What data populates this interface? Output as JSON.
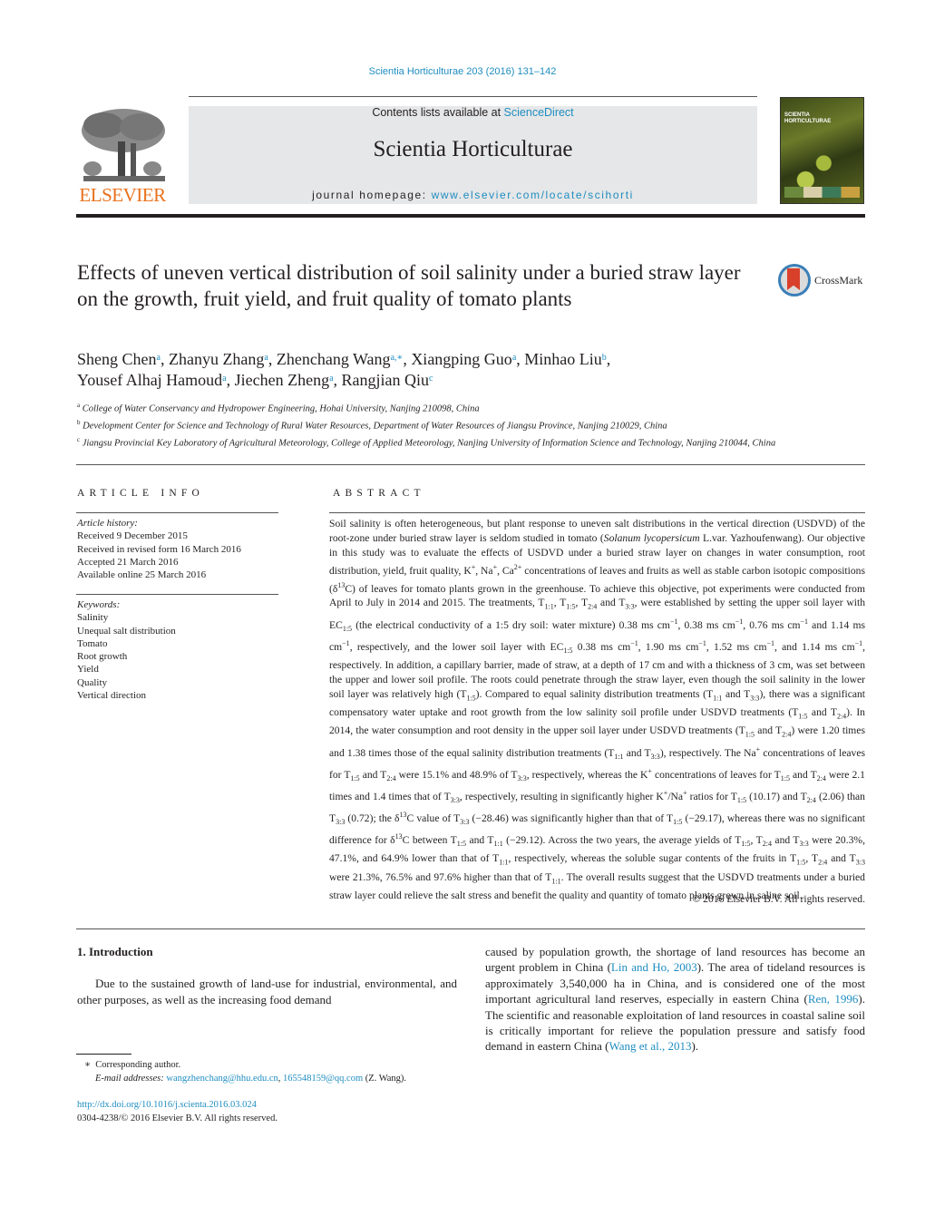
{
  "header": {
    "citation": "Scientia Horticulturae 203 (2016) 131–142",
    "contents_prefix": "Contents lists available at ",
    "contents_link": "ScienceDirect",
    "journal_name": "Scientia Horticulturae",
    "homepage_prefix": "journal homepage: ",
    "homepage_link": "www.elsevier.com/locate/scihorti",
    "publisher_logo_text": "ELSEVIER",
    "cover_title_line1": "SCIENTIA",
    "cover_title_line2": "HORTICULTURAE",
    "colors": {
      "link": "#1f8dc1",
      "publisher": "#e9711c",
      "box": "#e6e7e8"
    }
  },
  "article": {
    "title": "Effects of uneven vertical distribution of soil salinity under a buried straw layer on the growth, fruit yield, and fruit quality of tomato plants",
    "crossmark_label": "CrossMark",
    "authors": [
      {
        "name": "Sheng Chen",
        "sup": "a",
        "sep": ", "
      },
      {
        "name": "Zhanyu Zhang",
        "sup": "a",
        "sep": ", "
      },
      {
        "name": "Zhenchang Wang",
        "sup": "a,∗",
        "sep": ", "
      },
      {
        "name": "Xiangping Guo",
        "sup": "a",
        "sep": ", "
      },
      {
        "name": "Minhao Liu",
        "sup": "b",
        "sep": ","
      },
      {
        "name": "Yousef Alhaj Hamoud",
        "sup": "a",
        "sep": ", "
      },
      {
        "name": "Jiechen Zheng",
        "sup": "a",
        "sep": ", "
      },
      {
        "name": "Rangjian Qiu",
        "sup": "c",
        "sep": ""
      }
    ],
    "affiliations": [
      {
        "key": "a",
        "text": "College of Water Conservancy and Hydropower Engineering, Hohai University, Nanjing 210098, China"
      },
      {
        "key": "b",
        "text": "Development Center for Science and Technology of Rural Water Resources, Department of Water Resources of Jiangsu Province, Nanjing 210029, China"
      },
      {
        "key": "c",
        "text": "Jiangsu Provincial Key Laboratory of Agricultural Meteorology, College of Applied Meteorology, Nanjing University of Information Science and Technology, Nanjing 210044, China"
      }
    ]
  },
  "article_info": {
    "heading": "ARTICLE INFO",
    "history_label": "Article history:",
    "history": [
      "Received 9 December 2015",
      "Received in revised form 16 March 2016",
      "Accepted 21 March 2016",
      "Available online 25 March 2016"
    ],
    "keywords_label": "Keywords:",
    "keywords": [
      "Salinity",
      "Unequal salt distribution",
      "Tomato",
      "Root growth",
      "Yield",
      "Quality",
      "Vertical direction"
    ]
  },
  "abstract": {
    "heading": "ABSTRACT",
    "html": "Soil salinity is often heterogeneous, but plant response to uneven salt distributions in the vertical direction (USDVD) of the root-zone under buried straw layer is seldom studied in tomato (<i>Solanum lycopersicum</i> L.var. Yazhoufenwang). Our objective in this study was to evaluate the effects of USDVD under a buried straw layer on changes in water consumption, root distribution, yield, fruit quality, K<sup>+</sup>, Na<sup>+</sup>, Ca<sup>2+</sup> concentrations of leaves and fruits as well as stable carbon isotopic compositions (δ<sup>13</sup>C) of leaves for tomato plants grown in the greenhouse. To achieve this objective, pot experiments were conducted from April to July in 2014 and 2015. The treatments, T<sub>1:1</sub>, T<sub>1:5</sub>, T<sub>2:4</sub> and T<sub>3:3</sub>, were established by setting the upper soil layer with EC<sub>1:5</sub> (the electrical conductivity of a 1:5 dry soil: water mixture) 0.38 ms cm<sup>−1</sup>, 0.38 ms cm<sup>−1</sup>, 0.76 ms cm<sup>−1</sup> and 1.14 ms cm<sup>−1</sup>, respectively, and the lower soil layer with EC<sub>1:5</sub> 0.38 ms cm<sup>−1</sup>, 1.90 ms cm<sup>−1</sup>, 1.52 ms cm<sup>−1</sup>, and 1.14 ms cm<sup>−1</sup>, respectively. In addition, a capillary barrier, made of straw, at a depth of 17 cm and with a thickness of 3 cm, was set between the upper and lower soil profile. The roots could penetrate through the straw layer, even though the soil salinity in the lower soil layer was relatively high (T<sub>1:5</sub>). Compared to equal salinity distribution treatments (T<sub>1:1</sub> and T<sub>3:3</sub>), there was a significant compensatory water uptake and root growth from the low salinity soil profile under USDVD treatments (T<sub>1:5</sub> and T<sub>2:4</sub>). In 2014, the water consumption and root density in the upper soil layer under USDVD treatments (T<sub>1:5</sub> and T<sub>2:4</sub>) were 1.20 times and 1.38 times those of the equal salinity distribution treatments (T<sub>1:1</sub> and T<sub>3:3</sub>), respectively. The Na<sup>+</sup> concentrations of leaves for T<sub>1:5</sub> and T<sub>2:4</sub> were 15.1% and 48.9% of T<sub>3:3</sub>, respectively, whereas the K<sup>+</sup> concentrations of leaves for T<sub>1:5</sub> and T<sub>2:4</sub> were 2.1 times and 1.4 times that of T<sub>3:3</sub>, respectively, resulting in significantly higher K<sup>+</sup>/Na<sup>+</sup> ratios for T<sub>1:5</sub> (10.17) and T<sub>2:4</sub> (2.06) than T<sub>3:3</sub> (0.72); the δ<sup>13</sup>C value of T<sub>3:3</sub> (−28.46) was significantly higher than that of T<sub>1:5</sub> (−29.17), whereas there was no significant difference for δ<sup>13</sup>C between T<sub>1:5</sub> and T<sub>1:1</sub> (−29.12). Across the two years, the average yields of T<sub>1:5</sub>, T<sub>2:4</sub> and T<sub>3:3</sub> were 20.3%, 47.1%, and 64.9% lower than that of T<sub>1:1</sub>, respectively, whereas the soluble sugar contents of the fruits in T<sub>1:5</sub>, T<sub>2:4</sub> and T<sub>3:3</sub> were 21.3%, 76.5% and 97.6% higher than that of T<sub>1:1</sub>. The overall results suggest that the USDVD treatments under a buried straw layer could relieve the salt stress and benefit the quality and quantity of tomato plants grown in saline soil.",
    "copyright": "© 2016 Elsevier B.V. All rights reserved."
  },
  "introduction": {
    "heading": "1.  Introduction",
    "para1": "Due to the sustained growth of land-use for industrial, environmental, and other purposes, as well as the increasing food demand",
    "para2_parts": [
      {
        "t": "caused by population growth, the shortage of land resources has become an urgent problem in China ("
      },
      {
        "link": "Lin and Ho, 2003"
      },
      {
        "t": "). The area of tideland resources is approximately 3,540,000 ha in China, and is considered one of the most important agricultural land reserves, especially in eastern China ("
      },
      {
        "link": "Ren, 1996"
      },
      {
        "t": "). The scientific and reasonable exploitation of land resources in coastal saline soil is critically important for relieve the population pressure and satisfy food demand in eastern China ("
      },
      {
        "link": "Wang et al., 2013"
      },
      {
        "t": ")."
      }
    ]
  },
  "footnotes": {
    "corresponding_mark": "∗",
    "corresponding_text": "Corresponding author.",
    "email_label": "E-mail addresses:",
    "emails": [
      "wangzhenchang@hhu.edu.cn",
      "165548159@qq.com"
    ],
    "email_owner": "(Z. Wang).",
    "doi": "http://dx.doi.org/10.1016/j.scienta.2016.03.024",
    "issn_line": "0304-4238/© 2016 Elsevier B.V. All rights reserved."
  }
}
